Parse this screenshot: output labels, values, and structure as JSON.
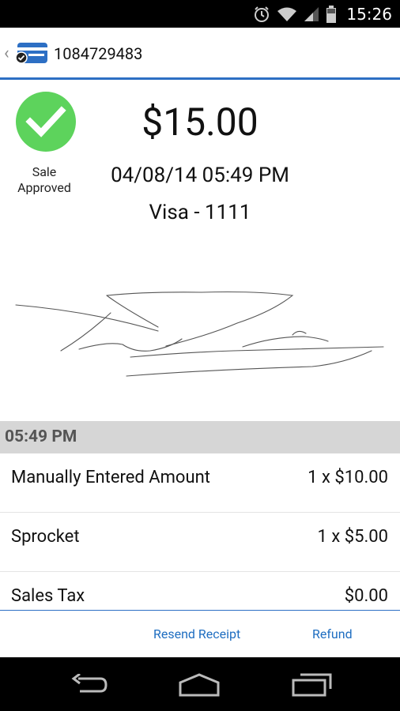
{
  "status_bar": {
    "time": "15:26"
  },
  "action_bar": {
    "title": "1084729483"
  },
  "transaction": {
    "amount": "$15.00",
    "status_line1": "Sale",
    "status_line2": "Approved",
    "datetime": "04/08/14 05:49 PM",
    "card": "Visa - 1111"
  },
  "section": {
    "time": "05:49 PM"
  },
  "items": [
    {
      "name": "Manually Entered Amount",
      "price": "1 x $10.00"
    },
    {
      "name": "Sprocket",
      "price": "1 x $5.00"
    },
    {
      "name": "Sales Tax",
      "price": "$0.00"
    }
  ],
  "footer": {
    "resend_label": "Resend Receipt",
    "refund_label": "Refund"
  },
  "colors": {
    "accent": "#2d6fc4",
    "approved_green": "#5dd35c",
    "link_blue": "#1f6ec1"
  },
  "icons": {
    "status": [
      "alarm-icon",
      "wifi-icon",
      "signal-icon",
      "battery-icon"
    ],
    "nav": [
      "back-nav-icon",
      "home-nav-icon",
      "recents-nav-icon"
    ]
  }
}
